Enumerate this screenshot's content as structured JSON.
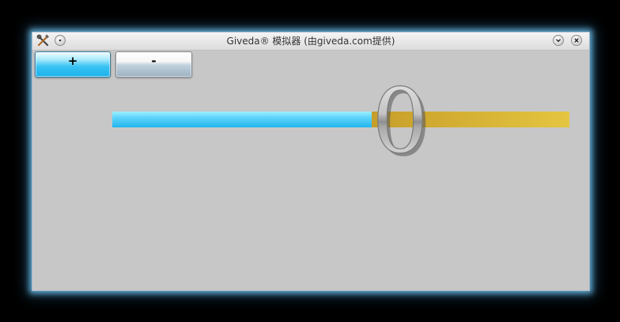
{
  "window": {
    "title": "Giveda® 模拟器 (由giveda.com提供)",
    "icons": [
      "tools-icon",
      "pin-icon",
      "minimize-icon",
      "close-icon"
    ],
    "glow_color": "#7fd4ff"
  },
  "buttons": {
    "increase_label": "+",
    "decrease_label": "-"
  },
  "slider": {
    "value": 0.567,
    "filled_color": "#3fcaf5",
    "remaining_color": "#d4b237"
  },
  "readout": {
    "value": "0"
  }
}
